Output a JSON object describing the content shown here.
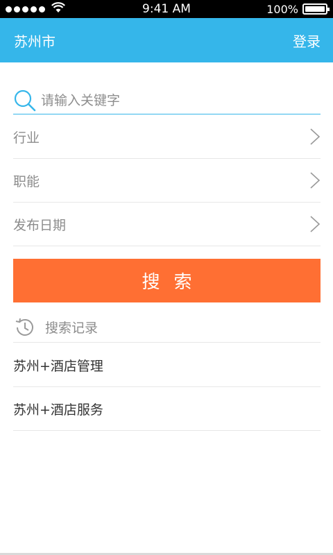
{
  "status_bar": {
    "time": "9:41 AM",
    "battery": "100%",
    "signal_icon": "signal-dots-icon",
    "wifi_icon": "wifi-icon",
    "battery_icon": "battery-icon",
    "battery_level": 1.0
  },
  "header": {
    "city": "苏州市",
    "login": "登录",
    "color": "#35b6ea"
  },
  "search": {
    "placeholder": "请输入关键字",
    "icon": "search-icon"
  },
  "filters": [
    {
      "label": "行业",
      "icon": "chevron-right-icon"
    },
    {
      "label": "职能",
      "icon": "chevron-right-icon"
    },
    {
      "label": "发布日期",
      "icon": "chevron-right-icon"
    }
  ],
  "search_button": {
    "label": "搜索",
    "color": "#ff6f33"
  },
  "history": {
    "title": "搜索记录",
    "icon": "history-icon",
    "items": [
      "苏州+酒店管理",
      "苏州+酒店服务"
    ]
  }
}
